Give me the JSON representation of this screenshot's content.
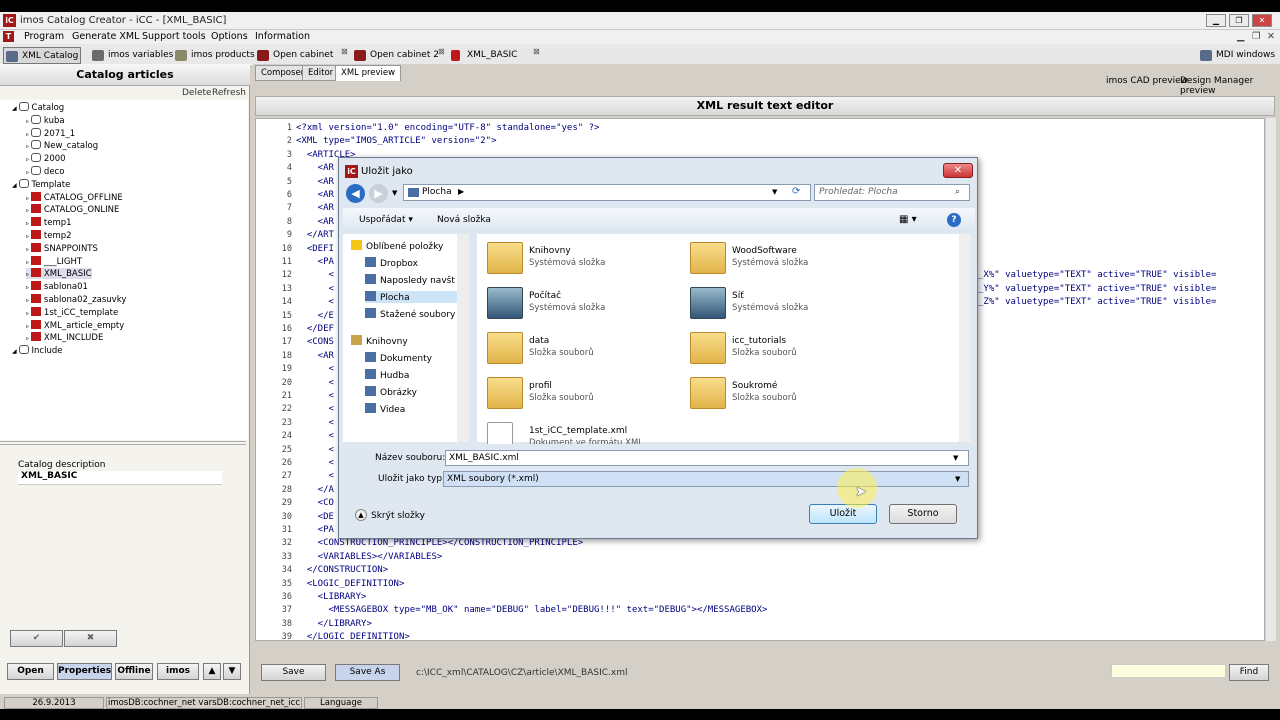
{
  "app": {
    "title": "imos Catalog Creator - iCC - [XML_BASIC]"
  },
  "menu": [
    "Program",
    "Generate XML",
    "Support tools",
    "Options",
    "Information"
  ],
  "toolbar": {
    "buttons": [
      "XML Catalog",
      "imos variables",
      "imos products"
    ],
    "docs": [
      "Open cabinet",
      "Open cabinet 2",
      "XML_BASIC"
    ],
    "mdi": "MDI windows"
  },
  "left": {
    "header": "Catalog articles",
    "delete": "Delete",
    "refresh": "Refresh",
    "tree": [
      {
        "label": "Catalog",
        "level": 0,
        "icon": "db"
      },
      {
        "label": "kuba",
        "level": 1,
        "icon": "db"
      },
      {
        "label": "2071_1",
        "level": 1,
        "icon": "db"
      },
      {
        "label": "New_catalog",
        "level": 1,
        "icon": "db"
      },
      {
        "label": "2000",
        "level": 1,
        "icon": "db"
      },
      {
        "label": "deco",
        "level": 1,
        "icon": "db"
      },
      {
        "label": "Template",
        "level": 0,
        "icon": "db"
      },
      {
        "label": "CATALOG_OFFLINE",
        "level": 1,
        "icon": "t"
      },
      {
        "label": "CATALOG_ONLINE",
        "level": 1,
        "icon": "t"
      },
      {
        "label": "temp1",
        "level": 1,
        "icon": "t"
      },
      {
        "label": "temp2",
        "level": 1,
        "icon": "t"
      },
      {
        "label": "SNAPPOINTS",
        "level": 1,
        "icon": "t"
      },
      {
        "label": "___LIGHT",
        "level": 1,
        "icon": "t"
      },
      {
        "label": "XML_BASIC",
        "level": 1,
        "icon": "t"
      },
      {
        "label": "sablona01",
        "level": 1,
        "icon": "t"
      },
      {
        "label": "sablona02_zasuvky",
        "level": 1,
        "icon": "t"
      },
      {
        "label": "1st_iCC_template",
        "level": 1,
        "icon": "t"
      },
      {
        "label": "XML_article_empty",
        "level": 1,
        "icon": "t"
      },
      {
        "label": "XML_INCLUDE",
        "level": 1,
        "icon": "t"
      },
      {
        "label": "Include",
        "level": 0,
        "icon": "db"
      }
    ],
    "desc_label": "Catalog description",
    "desc_value": "XML_BASIC",
    "ok": "✔",
    "cancel": "✖",
    "bottom": [
      "Open",
      "Properties",
      "Offline",
      "imos"
    ]
  },
  "right": {
    "tabs": [
      "Composer",
      "Editor",
      "XML preview"
    ],
    "links": [
      "imos CAD preview",
      "Design Manager preview"
    ],
    "header": "XML result text editor",
    "lines": [
      "<?xml version=\"1.0\" encoding=\"UTF-8\" standalone=\"yes\" ?>",
      "<XML type=\"IMOS_ARTICLE\" version=\"2\">",
      "  <ARTICLE>",
      "    <AR",
      "    <AR",
      "    <AR",
      "    <AR",
      "    <AR",
      "  </ART",
      "  <DEFI",
      "    <PA",
      "      <",
      "      <",
      "      <",
      "    </E",
      "  </DEF",
      "  <CONS",
      "    <AR",
      "      <",
      "      <",
      "      <",
      "      <",
      "      <",
      "      <",
      "      <",
      "      <",
      "      <",
      "    </A",
      "    <CO",
      "    <DE",
      "    <PA",
      "    <CONSTRUCTION_PRINCIPLE></CONSTRUCTION_PRINCIPLE>",
      "    <VARIABLES></VARIABLES>",
      "  </CONSTRUCTION>",
      "  <LOGIC_DEFINITION>",
      "    <LIBRARY>",
      "      <MESSAGEBOX type=\"MB_OK\" name=\"DEBUG\" label=\"DEBUG!!!\" text=\"DEBUG\"></MESSAGEBOX>",
      "    </LIBRARY>",
      "  </LOGIC_DEFINITION>"
    ],
    "tail": [
      "_X%\" valuetype=\"TEXT\" active=\"TRUE\" visible=",
      "_Y%\" valuetype=\"TEXT\" active=\"TRUE\" visible=",
      "_Z%\" valuetype=\"TEXT\" active=\"TRUE\" visible="
    ],
    "save": "Save",
    "saveas": "Save As",
    "path": "c:\\ICC_xml\\CATALOG\\CZ\\article\\XML_BASIC.xml",
    "find": "Find"
  },
  "status": {
    "date": "26.9.2013",
    "db": "imosDB:cochner_net  varsDB:cochner_net_icc",
    "lang": "Language"
  },
  "dialog": {
    "title": "Uložit jako",
    "location": "Plocha",
    "search": "Prohledat: Plocha",
    "organize": "Uspořádat",
    "newfolder": "Nová složka",
    "nav": [
      {
        "label": "Oblíbené položky",
        "lvl": 0
      },
      {
        "label": "Dropbox",
        "lvl": 1
      },
      {
        "label": "Naposledy navšt",
        "lvl": 1
      },
      {
        "label": "Plocha",
        "lvl": 1
      },
      {
        "label": "Stažené soubory",
        "lvl": 1
      },
      {
        "label": "Knihovny",
        "lvl": 0
      },
      {
        "label": "Dokumenty",
        "lvl": 1
      },
      {
        "label": "Hudba",
        "lvl": 1
      },
      {
        "label": "Obrázky",
        "lvl": 1
      },
      {
        "label": "Videa",
        "lvl": 1
      }
    ],
    "files": [
      {
        "name": "Knihovny",
        "sub": "Systémová složka"
      },
      {
        "name": "WoodSoftware",
        "sub": "Systémová složka"
      },
      {
        "name": "Počítač",
        "sub": "Systémová složka"
      },
      {
        "name": "Síť",
        "sub": "Systémová složka"
      },
      {
        "name": "data",
        "sub": "Složka souborů"
      },
      {
        "name": "icc_tutorials",
        "sub": "Složka souborů"
      },
      {
        "name": "profil",
        "sub": "Složka souborů"
      },
      {
        "name": "Soukromé",
        "sub": "Složka souborů"
      },
      {
        "name": "1st_iCC_template.xml",
        "sub": "Dokument ve formátu XML"
      }
    ],
    "fname_label": "Název souboru:",
    "fname": "XML_BASIC.xml",
    "ftype_label": "Uložit jako typ:",
    "ftype": "XML soubory (*.xml)",
    "hide": "Skrýt složky",
    "save": "Uložit",
    "cancel": "Storno"
  }
}
